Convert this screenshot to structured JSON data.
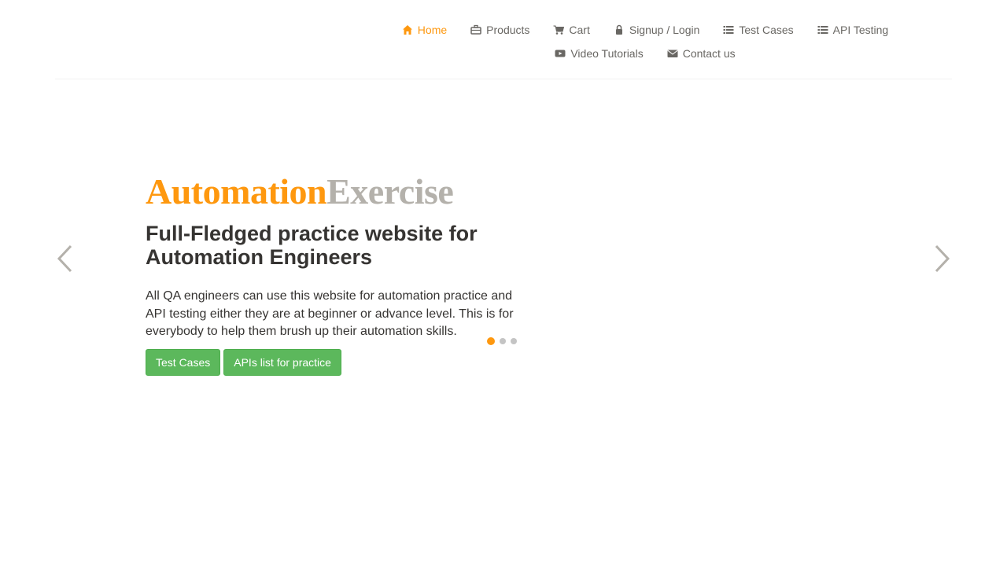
{
  "nav": {
    "home": {
      "label": "Home",
      "icon": "home-icon"
    },
    "products": {
      "label": "Products",
      "icon": "briefcase-icon"
    },
    "cart": {
      "label": "Cart",
      "icon": "cart-icon"
    },
    "signup": {
      "label": "Signup / Login",
      "icon": "lock-icon"
    },
    "test_cases": {
      "label": "Test Cases",
      "icon": "list-icon"
    },
    "api_testing": {
      "label": "API Testing",
      "icon": "list-icon"
    },
    "video_tutorials": {
      "label": "Video Tutorials",
      "icon": "youtube-play-icon"
    },
    "contact": {
      "label": "Contact us",
      "icon": "envelope-icon"
    }
  },
  "hero": {
    "brand_part1": "Automation",
    "brand_part2": "Exercise",
    "headline": "Full-Fledged practice website for Automation Engineers",
    "description": "All QA engineers can use this website for automation practice and API testing either they are at beginner or advance level. This is for everybody to help them brush up their automation skills.",
    "button_test_cases": "Test Cases",
    "button_apis": "APIs list for practice"
  },
  "carousel": {
    "slide_count": 3,
    "active_index": 0,
    "prev_icon": "chevron-left-icon",
    "next_icon": "chevron-right-icon"
  },
  "colors": {
    "accent": "#FE980F",
    "brand_secondary": "#B4B1AB",
    "button_green": "#5CB85C",
    "nav_text": "#696763",
    "body_text": "#363432"
  }
}
